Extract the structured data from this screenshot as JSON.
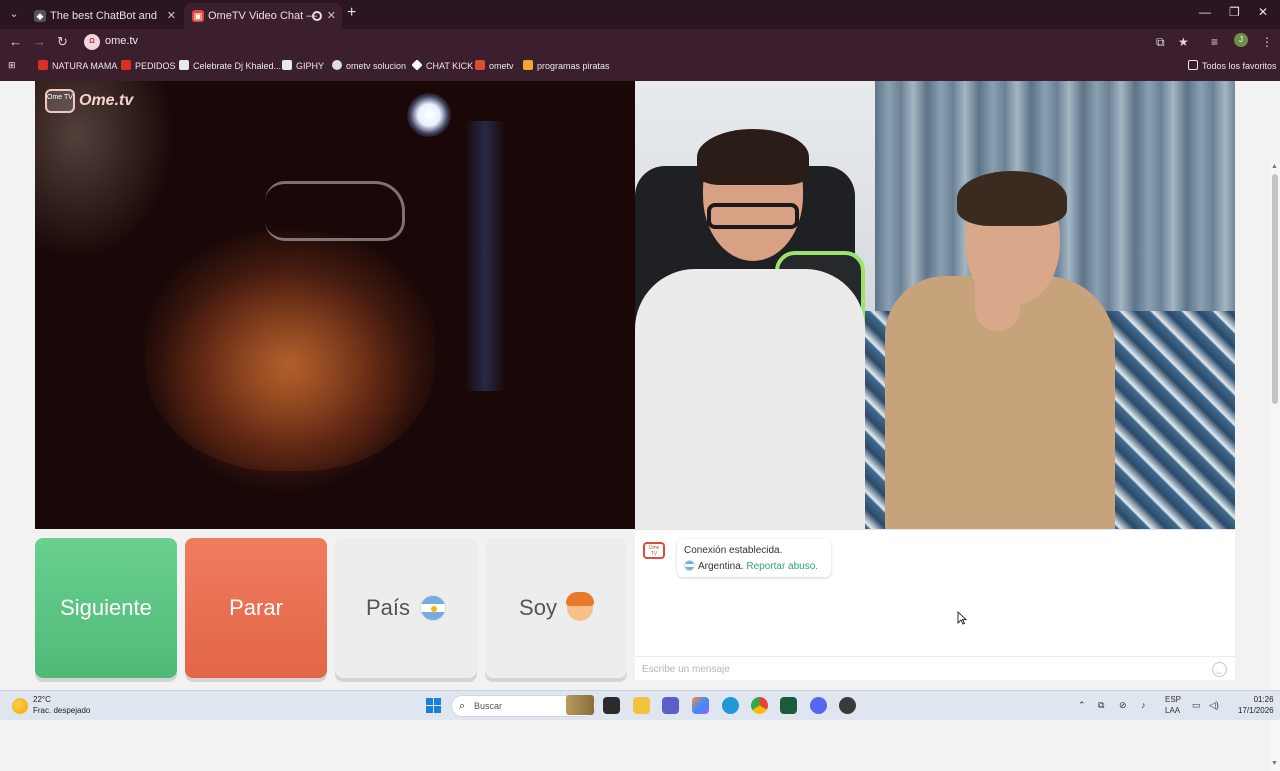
{
  "browser": {
    "tabs": [
      {
        "title": "The best ChatBot and Widgets",
        "active": false
      },
      {
        "title": "OmeTV Video Chat — Ome",
        "active": true
      }
    ],
    "url": "ome.tv",
    "site_icon_text": "Ω",
    "profile_initial": "J",
    "bookmarks": [
      {
        "label": "NATURA MAMA",
        "color": "#d93025"
      },
      {
        "label": "PEDIDOS",
        "color": "#d93025"
      },
      {
        "label": "Celebrate Dj Khaled...",
        "color": "#f2f2f2"
      },
      {
        "label": "GIPHY",
        "color": "#f2f2f2"
      },
      {
        "label": "ometv solucion",
        "color": "#ffffff"
      },
      {
        "label": "CHAT KICK",
        "color": "#ffffff"
      },
      {
        "label": "ometv",
        "color": "#e04a3a"
      },
      {
        "label": "programas piratas",
        "color": "#f0a830"
      }
    ],
    "bookmarks_folder": "Todos los favoritos"
  },
  "app": {
    "brand": "Ome.tv",
    "brand_icon_text": "Ome TV",
    "buttons": {
      "next": "Siguiente",
      "stop": "Parar",
      "country": "País",
      "gender": "Soy"
    },
    "country_flag_icon": "argentina-flag-icon",
    "gender_icon": "boy-emoji-icon",
    "chat": {
      "logo_text": "Ome TV",
      "system_line1": "Conexión establecida.",
      "country": "Argentina.",
      "report_link": "Reportar abuso.",
      "input_placeholder": "Escribe un mensaje"
    },
    "colors": {
      "next": "#4fba77",
      "stop": "#e26546",
      "report_link": "#2aa57a"
    }
  },
  "taskbar": {
    "temperature": "22°C",
    "weather_desc": "Frac. despejado",
    "search_placeholder": "Buscar",
    "lang_line1": "ESP",
    "lang_line2": "LAA",
    "time": "01:26",
    "date": "17/1/2026"
  }
}
